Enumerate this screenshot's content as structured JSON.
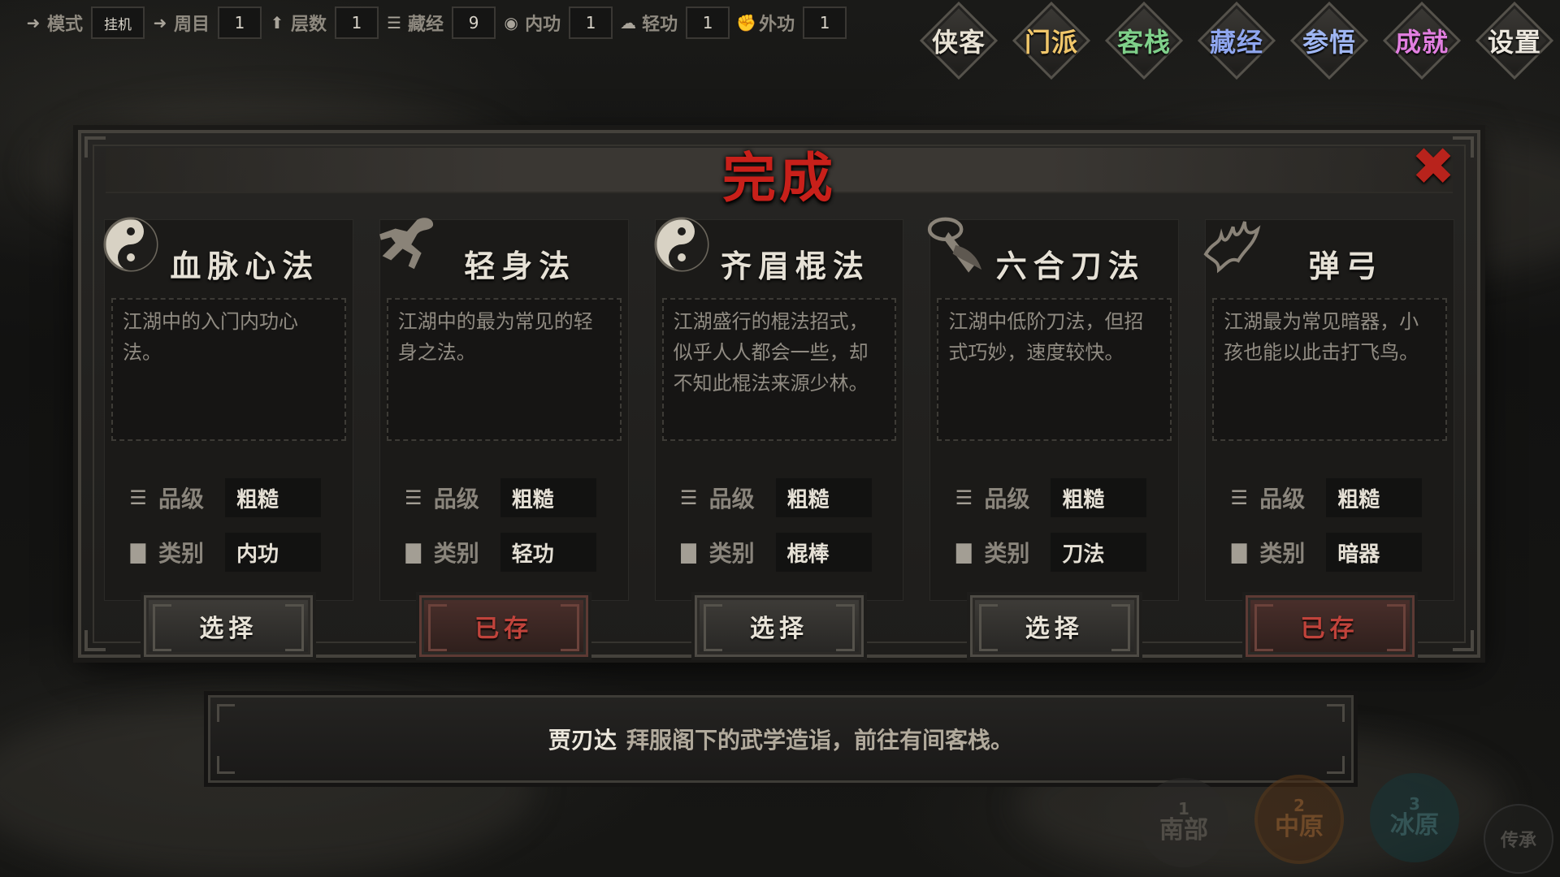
{
  "topbar": {
    "stats": [
      {
        "label": "模式",
        "value": "挂机",
        "icon": "arrow-right-icon"
      },
      {
        "label": "周目",
        "value": "1",
        "icon": "arrow-right-icon"
      },
      {
        "label": "层数",
        "value": "1",
        "icon": "arrow-up-icon"
      },
      {
        "label": "藏经",
        "value": "9",
        "icon": "sort-icon"
      },
      {
        "label": "内功",
        "value": "1",
        "icon": "circle-icon"
      },
      {
        "label": "轻功",
        "value": "1",
        "icon": "cloud-icon"
      },
      {
        "label": "外功",
        "value": "1",
        "icon": "fist-icon"
      }
    ]
  },
  "nav": {
    "items": [
      {
        "label": "侠客",
        "color": "#e8e2d4"
      },
      {
        "label": "门派",
        "color": "#f0c66a"
      },
      {
        "label": "客栈",
        "color": "#7fd08a"
      },
      {
        "label": "藏经",
        "color": "#8fa6ee"
      },
      {
        "label": "参悟",
        "color": "#9fb6f2"
      },
      {
        "label": "成就",
        "color": "#e27fe0"
      },
      {
        "label": "设置",
        "color": "#ece7de"
      }
    ]
  },
  "dialog": {
    "title": "完成",
    "close_icon": "close-x-icon",
    "grade_label": "品级",
    "category_label": "类别",
    "cards": [
      {
        "name": "血脉心法",
        "emblem": "yin-yang-icon",
        "desc": "江湖中的入门内功心法。",
        "grade": "粗糙",
        "category": "内功",
        "action": "选择",
        "state": "select"
      },
      {
        "name": "轻身法",
        "emblem": "running-figure-icon",
        "desc": "江湖中的最为常见的轻身之法。",
        "grade": "粗糙",
        "category": "轻功",
        "action": "已存",
        "state": "saved"
      },
      {
        "name": "齐眉棍法",
        "emblem": "yin-yang-icon",
        "desc": "江湖盛行的棍法招式，似乎人人都会一些，却不知此棍法来源少林。",
        "grade": "粗糙",
        "category": "棍棒",
        "action": "选择",
        "state": "select"
      },
      {
        "name": "六合刀法",
        "emblem": "blade-icon",
        "desc": "江湖中低阶刀法，但招式巧妙，速度较快。",
        "grade": "粗糙",
        "category": "刀法",
        "action": "选择",
        "state": "select"
      },
      {
        "name": "弹弓",
        "emblem": "claw-icon",
        "desc": "江湖最为常见暗器，小孩也能以此击打飞鸟。",
        "grade": "粗糙",
        "category": "暗器",
        "action": "已存",
        "state": "saved"
      }
    ]
  },
  "message": {
    "speaker": "贾刃达",
    "text": "拜服阁下的武学造诣，前往有间客栈。"
  },
  "regions": [
    {
      "num": "1",
      "label": "南部",
      "color": "#4a4844"
    },
    {
      "num": "2",
      "label": "中原",
      "color": "#7a4a22"
    },
    {
      "num": "3",
      "label": "冰原",
      "color": "#1f4a4e"
    }
  ],
  "legacy_label": "传承"
}
